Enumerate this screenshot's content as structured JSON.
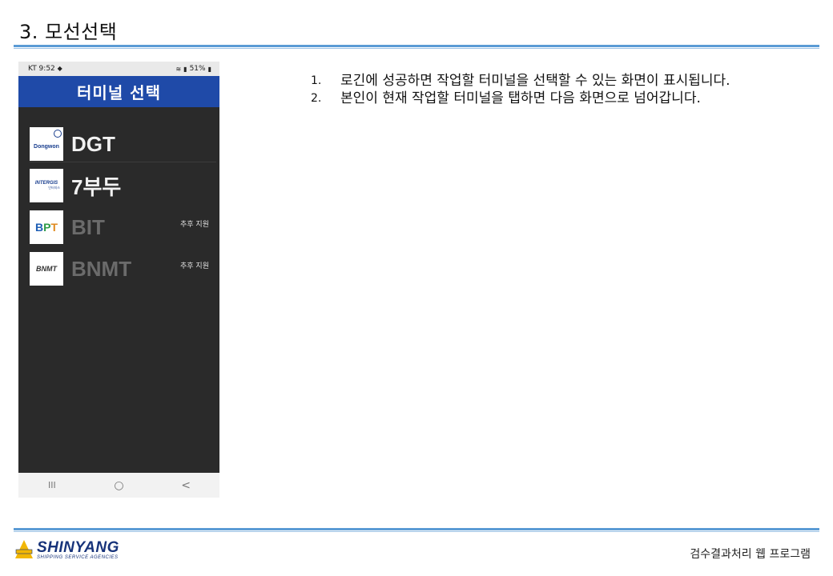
{
  "slide": {
    "title": "3. 모선선택"
  },
  "phone": {
    "status_left": "KT 9:52",
    "status_right": "51%",
    "header_title": "터미널 선택",
    "terminals": [
      {
        "name": "DGT",
        "logo_text": "Dongwon",
        "note": ""
      },
      {
        "name": "7부두",
        "logo_text": "INTERGIS",
        "logo_sub": "인터지스",
        "note": ""
      },
      {
        "name": "BIT",
        "logo_text": "BPT",
        "note": "추후 지원"
      },
      {
        "name": "BNMT",
        "logo_text": "BNMT",
        "note": "추후 지원"
      }
    ],
    "nav": {
      "recent": "III",
      "home": "○",
      "back": "<"
    }
  },
  "instructions": [
    {
      "num": "1.",
      "text": "로긴에 성공하면 작업할 터미널을 선택할 수 있는 화면이 표시됩니다."
    },
    {
      "num": "2.",
      "text": "본인이 현재 작업할 터미널을 탭하면 다음 화면으로 넘어갑니다."
    }
  ],
  "footer": {
    "brand": "SHINYANG",
    "brand_sub": "SHIPPING SERVICE AGENCIES",
    "caption": "검수결과처리 웹 프로그램"
  },
  "colors": {
    "header_blue": "#1f4aa8",
    "rule_blue": "#5b9bd5",
    "brand_navy": "#17337a",
    "brand_gold": "#f2b705"
  }
}
